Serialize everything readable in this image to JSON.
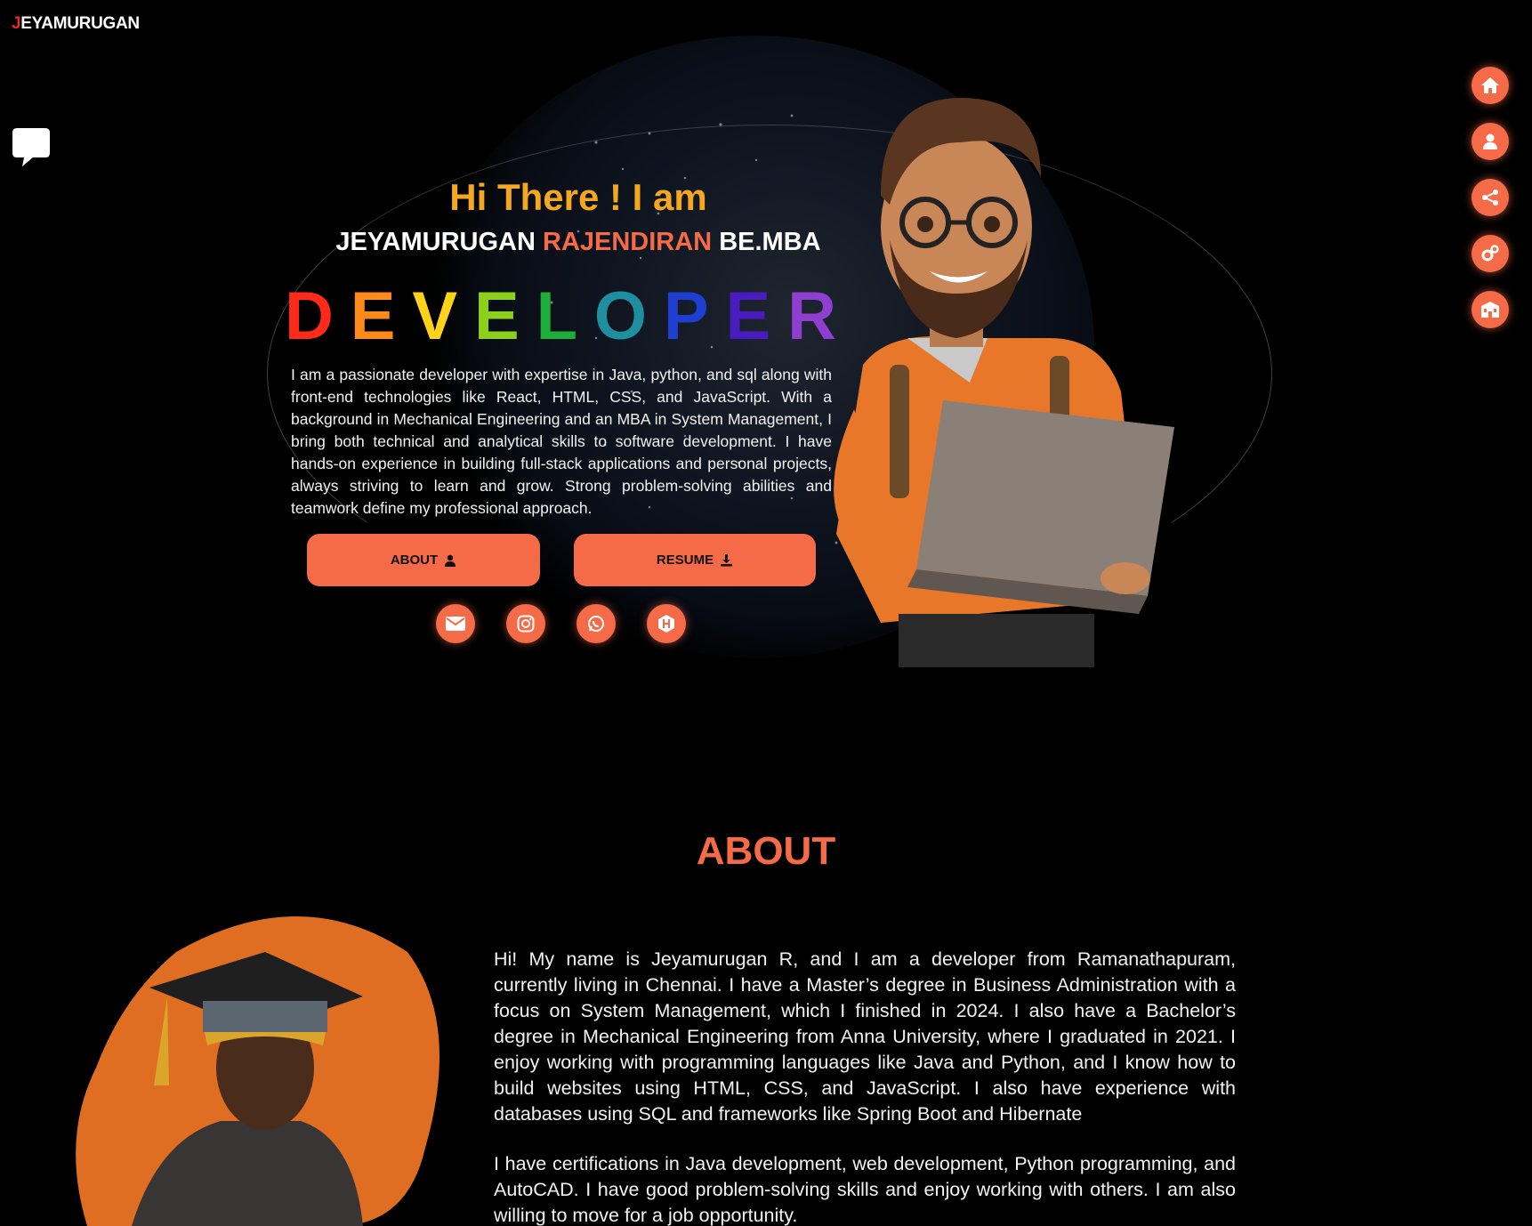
{
  "brand": {
    "logo_first": "J",
    "logo_rest": "EYAMURUGAN"
  },
  "side_nav": {
    "items": [
      "home-icon",
      "user-icon",
      "share-icon",
      "gears-icon",
      "school-icon"
    ]
  },
  "hero": {
    "greeting": "Hi There ! I am",
    "name_first": "JEYAMURUGAN",
    "name_highlight": "RAJENDIRAN",
    "name_suffix": "BE.MBA",
    "role_letters": [
      "D",
      "E",
      "V",
      "E",
      "L",
      "O",
      "P",
      "E",
      "R"
    ],
    "intro": "I am a passionate developer with expertise in Java, python, and sql along with front-end technologies like React, HTML, CSS, and JavaScript. With a background in Mechanical Engineering and an MBA in System Management, I bring both technical and analytical skills to software development. I have hands-on experience in building full-stack applications and personal projects, always striving to learn and grow. Strong problem-solving abilities and teamwork define my professional approach.",
    "about_button": "ABOUT",
    "resume_button": "RESUME",
    "socials": [
      "mail-icon",
      "instagram-icon",
      "whatsapp-icon",
      "hackerrank-icon"
    ]
  },
  "about": {
    "title": "ABOUT",
    "paragraph_1": "Hi! My name is Jeyamurugan R, and I am a developer from Ramanathapuram, currently living in Chennai. I have a Master’s degree in Business Administration with a focus on System Management, which I finished in 2024. I also have a Bachelor’s degree in Mechanical Engineering from Anna University, where I graduated in 2021. I enjoy working with programming languages like Java and Python, and I know how to build websites using HTML, CSS, and JavaScript. I also have experience with databases using SQL and frameworks like Spring Boot and Hibernate",
    "paragraph_2": "I have certifications in Java development, web development, Python programming, and AutoCAD. I have good problem-solving skills and enjoy working with others. I am also willing to move for a job opportunity."
  },
  "colors": {
    "accent": "#f56a47",
    "greeting": "#f4a822",
    "background": "#000000"
  }
}
